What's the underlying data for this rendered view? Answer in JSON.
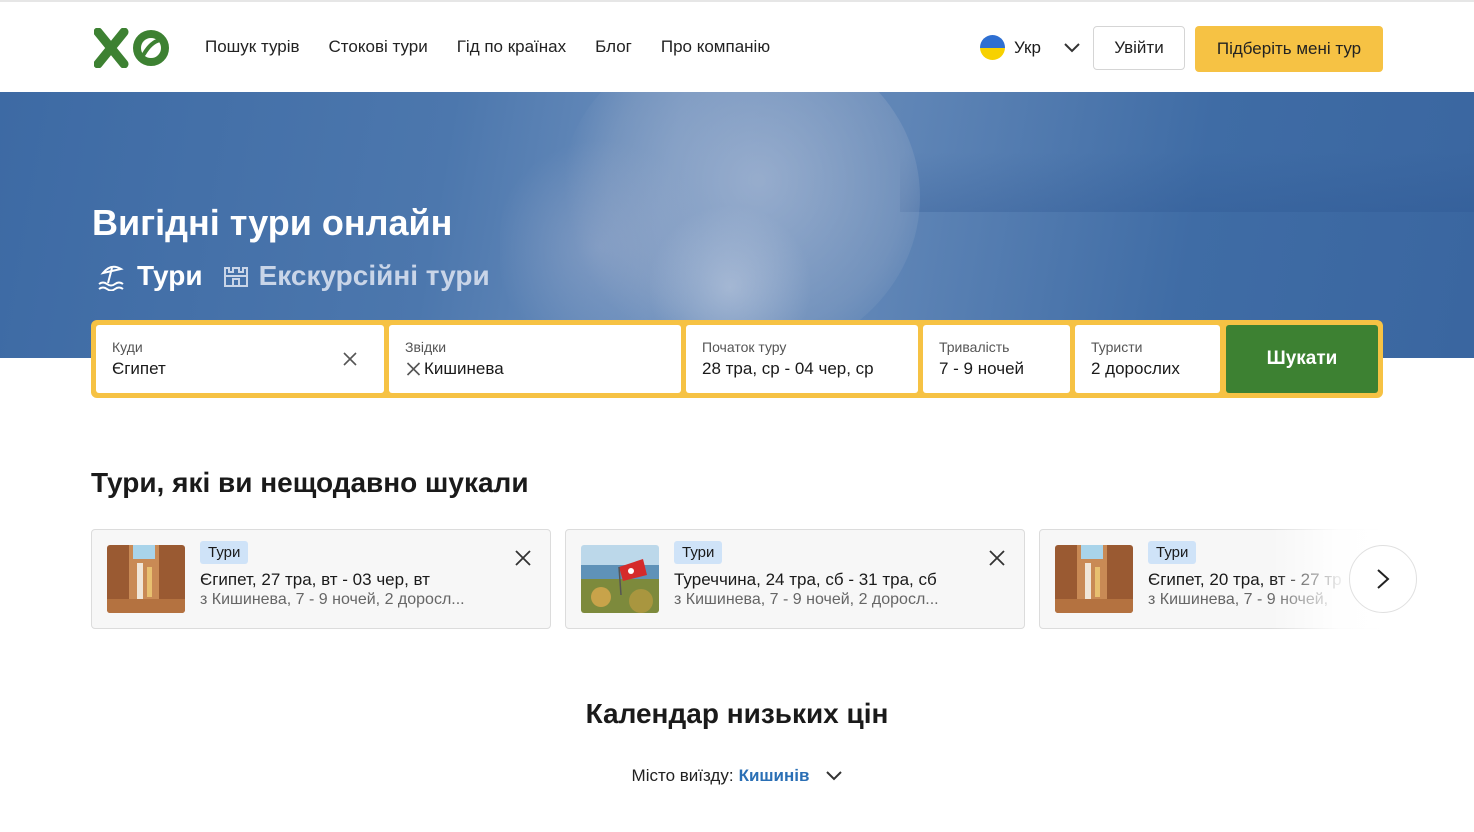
{
  "header": {
    "logo_text": "XO",
    "nav": [
      "Пошук турів",
      "Стокові тури",
      "Гід по країнах",
      "Блог",
      "Про компанію"
    ],
    "lang": "Укр",
    "login": "Увійти",
    "pick_tour": "Підберіть мені тур",
    "colors": {
      "brand_green": "#3d8132",
      "accent_yellow": "#f6c244"
    }
  },
  "hero": {
    "title": "Вигідні тури онлайн",
    "tabs": [
      {
        "label": "Тури",
        "icon": "beach-umbrella-icon",
        "active": true
      },
      {
        "label": "Екскурсійні тури",
        "icon": "castle-icon",
        "active": false
      }
    ]
  },
  "search": {
    "to": {
      "label": "Куди",
      "value": "Єгипет"
    },
    "from": {
      "label": "Звідки",
      "value": "Кишинева"
    },
    "start": {
      "label": "Початок туру",
      "value": "28 тра, ср - 04 чер, ср"
    },
    "duration": {
      "label": "Тривалість",
      "value": "7 - 9 ночей"
    },
    "tourists": {
      "label": "Туристи",
      "value": "2 дорослих"
    },
    "submit": "Шукати"
  },
  "recent": {
    "title": "Тури, які ви нещодавно шукали",
    "cards": [
      {
        "badge": "Тури",
        "title": "Єгипет, 27 тра, вт - 03 чер, вт",
        "subtitle": "з Кишинева, 7 - 9 ночей, 2 доросл..."
      },
      {
        "badge": "Тури",
        "title": "Туреччина, 24 тра, сб - 31 тра, сб",
        "subtitle": "з Кишинева, 7 - 9 ночей, 2 доросл..."
      },
      {
        "badge": "Тури",
        "title": "Єгипет, 20 тра, вт - 27 тр",
        "subtitle": "з Кишинева, 7 - 9 ночей,"
      }
    ]
  },
  "calendar": {
    "title": "Календар низьких цін",
    "city_label": "Місто виїзду:",
    "city": "Кишинів"
  }
}
